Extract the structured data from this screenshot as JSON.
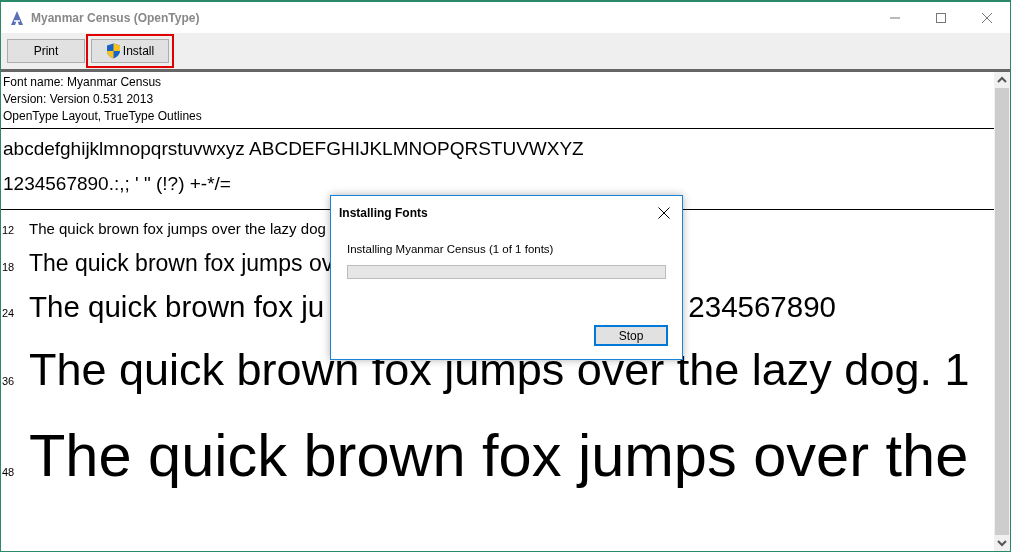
{
  "window": {
    "title": "Myanmar Census (OpenType)"
  },
  "toolbar": [
    {
      "label": "Print",
      "shield": false,
      "highlighted": false
    },
    {
      "label": "Install",
      "shield": true,
      "highlighted": true
    }
  ],
  "info": [
    "Font name: Myanmar Census",
    "Version: Version 0.531 2013",
    "OpenType Layout, TrueType Outlines"
  ],
  "charset": [
    "abcdefghijklmnopqrstuvwxyz ABCDEFGHIJKLMNOPQRSTUVWXYZ",
    "1234567890.:,; ' \" (!?) +-*/="
  ],
  "samples": [
    {
      "size": "12",
      "text": "The quick brown fox jumps over the lazy dog"
    },
    {
      "size": "18",
      "text": "The quick brown fox jumps ov"
    },
    {
      "size": "24",
      "text": "The quick brown fox ju",
      "tail": "234567890"
    },
    {
      "size": "36",
      "text": "The quick brown fox jumps over the lazy dog. 1"
    },
    {
      "size": "48",
      "text": "The quick brown fox jumps over the"
    }
  ],
  "dialog": {
    "title": "Installing Fonts",
    "message": "Installing Myanmar Census (1 of 1 fonts)",
    "level": 0,
    "button": "Stop"
  }
}
